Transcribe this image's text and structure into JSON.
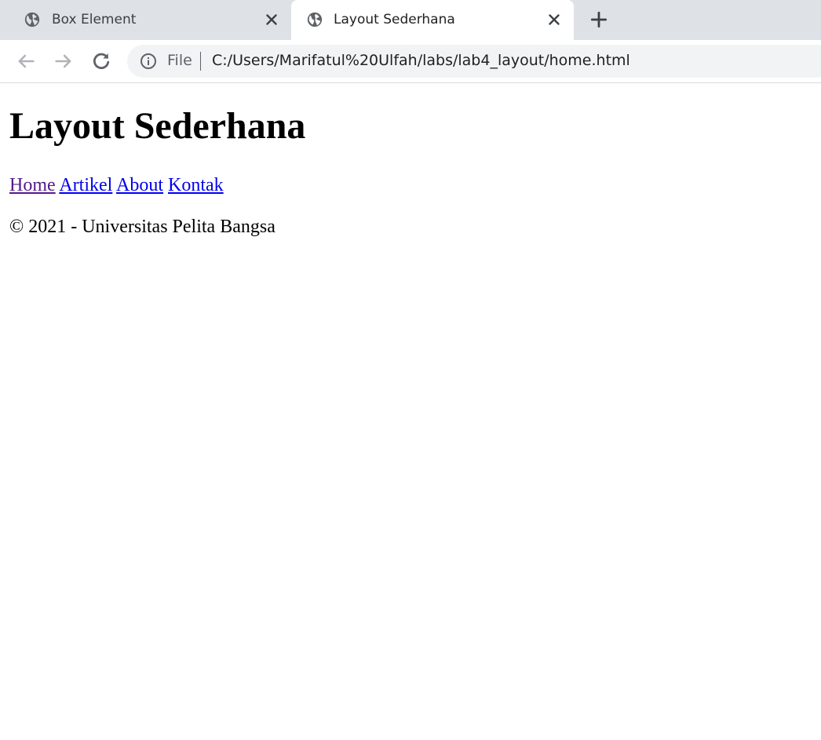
{
  "tabs": [
    {
      "title": "Box Element",
      "active": false,
      "icon": "globe-icon"
    },
    {
      "title": "Layout Sederhana",
      "active": true,
      "icon": "globe-icon"
    }
  ],
  "toolbar": {
    "scheme_label": "File",
    "url": "C:/Users/Marifatul%20Ulfah/labs/lab4_layout/home.html"
  },
  "page": {
    "heading": "Layout Sederhana",
    "nav_links": [
      "Home",
      "Artikel",
      "About",
      "Kontak"
    ],
    "footer": "© 2021 - Universitas Pelita Bangsa"
  },
  "colors": {
    "tabstrip": "#dee1e6",
    "link": "#0000ee",
    "visited_link": "#551a8b",
    "omnibox": "#f1f3f4"
  }
}
